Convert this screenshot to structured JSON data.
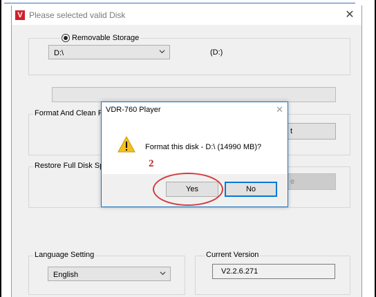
{
  "window": {
    "title": "Please selected valid Disk",
    "logo_text": "V",
    "close_glyph": "✕"
  },
  "storage": {
    "radio_label": "Removable Storage",
    "drive_selected": "D:\\",
    "drive_display": "(D:)"
  },
  "format_group": {
    "label": "Format And Clean R"
  },
  "restore_group": {
    "label": "Restore Full Disk Sp"
  },
  "obscured_button_fragments": {
    "format_btn_tail": "t",
    "restore_btn_tail": "e"
  },
  "language": {
    "label": "Language Setting",
    "selected": "English"
  },
  "version": {
    "label": "Current Version",
    "value": "V2.2.6.271"
  },
  "dialog": {
    "title": "VDR-760 Player",
    "close_glyph": "✕",
    "message": "Format this disk - D:\\ (14990 MB)?",
    "icon": "warning-icon",
    "yes_label": "Yes",
    "no_label": "No"
  },
  "annotation": {
    "step_number": "2",
    "color": "#d33b3b"
  },
  "colors": {
    "accent": "#0078d7",
    "logo_red": "#d11f2b",
    "warning_yellow": "#f4c020"
  }
}
